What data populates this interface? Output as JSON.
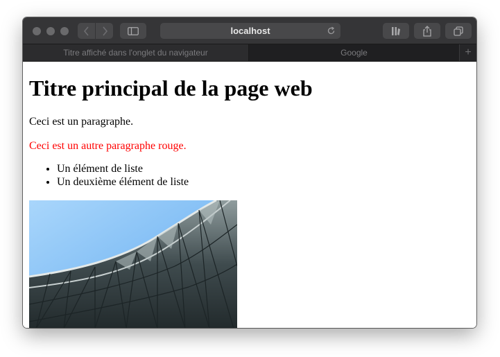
{
  "browser": {
    "address": "localhost",
    "tabs": [
      {
        "label": "Titre affiché dans l'onglet du navigateur",
        "active": false
      },
      {
        "label": "Google",
        "active": true
      }
    ],
    "new_tab_symbol": "+"
  },
  "page": {
    "heading": "Titre principal de la page web",
    "paragraph": "Ceci est un paragraphe.",
    "red_paragraph": "Ceci est un autre paragraphe rouge.",
    "red_color": "#ff0000",
    "list": [
      "Un élément de liste",
      "Un deuxième élément de liste"
    ],
    "image_icon": "architecture-photo"
  },
  "icons": {
    "back": "chevron-left-icon",
    "forward": "chevron-right-icon",
    "sidebar": "sidebar-icon",
    "reload": "reload-icon",
    "reading_list": "reading-list-icon",
    "share": "share-icon",
    "tabs_overview": "tabs-overview-icon"
  }
}
